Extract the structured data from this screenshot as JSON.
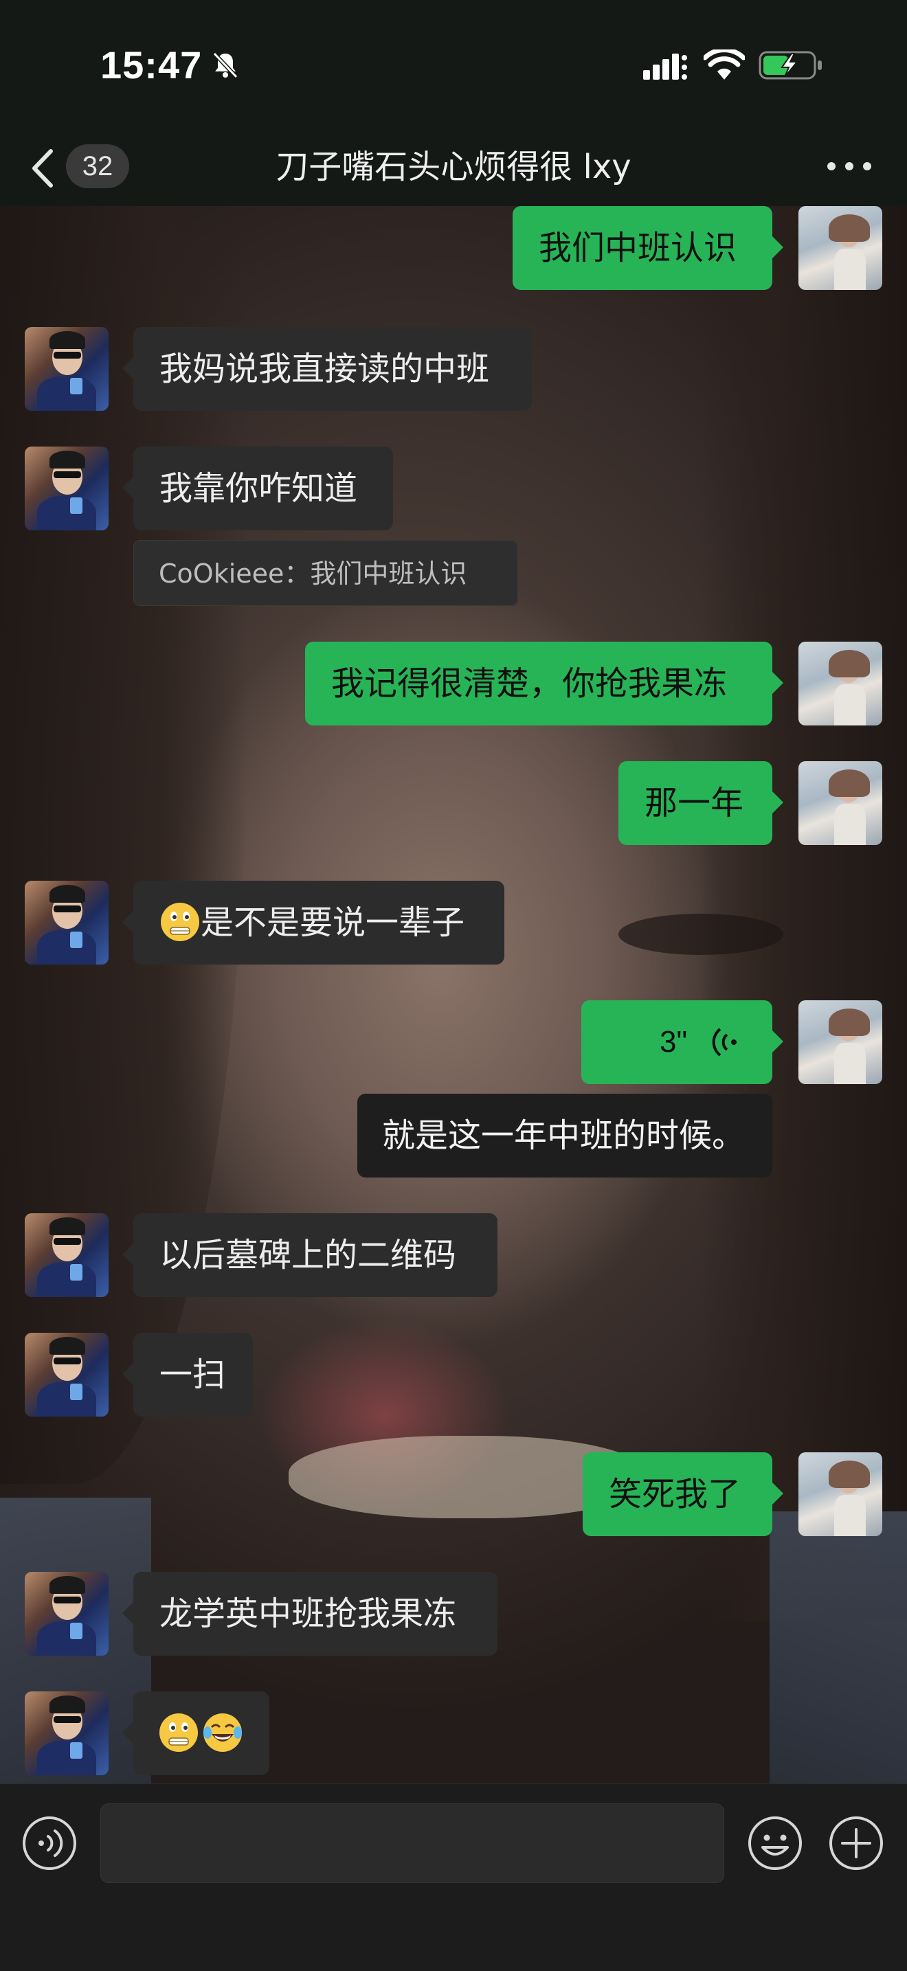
{
  "status_bar": {
    "time": "15:47"
  },
  "nav": {
    "unread_count": "32",
    "title": "刀子嘴石头心烦得很 lxy"
  },
  "messages": [
    {
      "side": "out",
      "text": "我们中班认识"
    },
    {
      "side": "in",
      "text": "我妈说我直接读的中班"
    },
    {
      "side": "in",
      "text": "我靠你咋知道",
      "quote": "CoOkieee：我们中班认识"
    },
    {
      "side": "out",
      "text": "我记得很清楚，你抢我果冻"
    },
    {
      "side": "out",
      "text": "那一年"
    },
    {
      "side": "in",
      "text": "是不是要说一辈子",
      "emoji": "grimacing-face"
    },
    {
      "side": "out",
      "type": "voice",
      "duration": "3\""
    },
    {
      "side": "out",
      "type": "transcript",
      "text": "就是这一年中班的时候。"
    },
    {
      "side": "in",
      "text": "以后墓碑上的二维码"
    },
    {
      "side": "in",
      "text": "一扫"
    },
    {
      "side": "out",
      "text": "笑死我了"
    },
    {
      "side": "in",
      "text": "龙学英中班抢我果冻"
    },
    {
      "side": "in",
      "type": "emoji-only",
      "emojis": [
        "grimacing-face",
        "tears-of-joy-face"
      ]
    }
  ],
  "input": {
    "value": "",
    "placeholder": ""
  },
  "colors": {
    "outgoing_bubble": "#27b457",
    "incoming_bubble": "#2c2c2c",
    "bar": "#141915"
  },
  "icons": [
    "back-chevron-icon",
    "bell-slash-icon",
    "signal-icon",
    "wifi-icon",
    "battery-charging-icon",
    "more-dots-icon",
    "voice-input-icon",
    "emoji-icon",
    "plus-icon"
  ]
}
